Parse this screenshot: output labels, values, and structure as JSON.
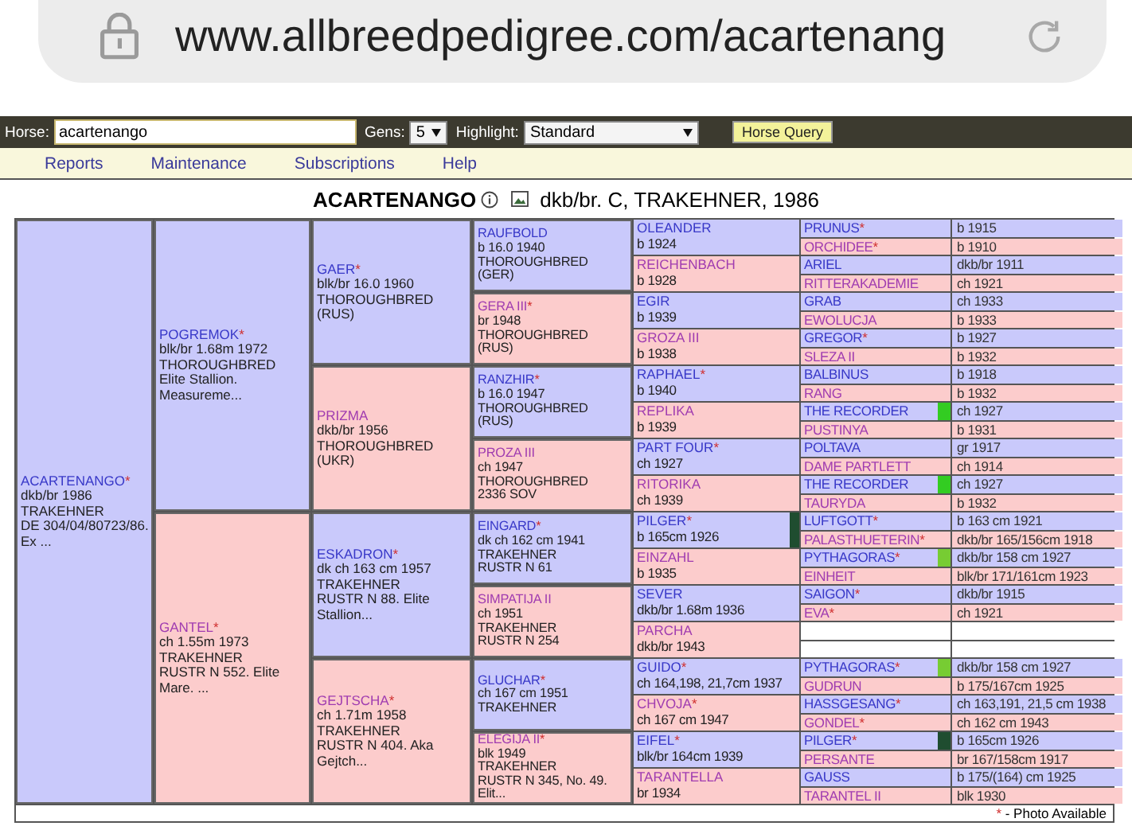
{
  "browser": {
    "url": "www.allbreedpedigree.com/acartenang"
  },
  "query_bar": {
    "horse_label": "Horse:",
    "horse_value": "acartenango",
    "gens_label": "Gens:",
    "gens_value": "5",
    "highlight_label": "Highlight:",
    "highlight_value": "Standard",
    "button": "Horse Query"
  },
  "menu": [
    "Reports",
    "Maintenance",
    "Subscriptions",
    "Help"
  ],
  "title": {
    "name": "ACARTENANGO",
    "details": "dkb/br. C, TRAKEHNER, 1986"
  },
  "pedigree": {
    "kind": "male",
    "name": "ACARTENANGO",
    "mark": "*",
    "info": [
      "dkb/br 1986",
      "TRAKEHNER",
      "DE 304/04/80723/86. Ex ..."
    ],
    "children": [
      {
        "kind": "male",
        "name": "POGREMOK",
        "mark": "*",
        "info": [
          "blk/br 1.68m 1972",
          "THOROUGHBRED",
          "Elite Stallion. Measureme..."
        ],
        "children": [
          {
            "kind": "male",
            "name": "GAER",
            "mark": "*",
            "info": [
              "blk/br 16.0 1960",
              "THOROUGHBRED",
              "(RUS)"
            ],
            "children": [
              {
                "kind": "male",
                "name": "RAUFBOLD",
                "info": [
                  "b 16.0 1940",
                  "THOROUGHBRED",
                  "(GER)"
                ],
                "children": [
                  {
                    "kind": "male",
                    "name": "OLEANDER",
                    "info": [
                      "b 1924"
                    ],
                    "children": [
                      {
                        "kind": "male",
                        "name": "PRUNUS",
                        "mark": "*",
                        "info": [
                          "b 1915"
                        ]
                      },
                      {
                        "kind": "female",
                        "name": "ORCHIDEE",
                        "mark": "*",
                        "info": [
                          "b 1910"
                        ]
                      }
                    ]
                  },
                  {
                    "kind": "female",
                    "name": "REICHENBACH",
                    "info": [
                      "b 1928"
                    ],
                    "children": [
                      {
                        "kind": "male",
                        "name": "ARIEL",
                        "info": [
                          "dkb/br 1911"
                        ]
                      },
                      {
                        "kind": "female",
                        "name": "RITTERAKADEMIE",
                        "info": [
                          "ch 1921"
                        ]
                      }
                    ]
                  }
                ]
              },
              {
                "kind": "female",
                "name": "GERA III",
                "mark": "*",
                "info": [
                  "br 1948",
                  "THOROUGHBRED",
                  "(RUS)"
                ],
                "children": [
                  {
                    "kind": "male",
                    "name": "EGIR",
                    "info": [
                      "b 1939"
                    ],
                    "children": [
                      {
                        "kind": "male",
                        "name": "GRAB",
                        "info": [
                          "ch 1933"
                        ]
                      },
                      {
                        "kind": "female",
                        "name": "EWOLUCJA",
                        "info": [
                          "b 1933"
                        ]
                      }
                    ]
                  },
                  {
                    "kind": "female",
                    "name": "GROZA III",
                    "info": [
                      "b 1938"
                    ],
                    "children": [
                      {
                        "kind": "male",
                        "name": "GREGOR",
                        "mark": "*",
                        "info": [
                          "b 1927"
                        ]
                      },
                      {
                        "kind": "female",
                        "name": "SLEZA II",
                        "info": [
                          "b 1932"
                        ]
                      }
                    ]
                  }
                ]
              }
            ]
          },
          {
            "kind": "female",
            "name": "PRIZMA",
            "info": [
              "dkb/br 1956",
              "THOROUGHBRED",
              "(UKR)"
            ],
            "children": [
              {
                "kind": "male",
                "name": "RANZHIR",
                "mark": "*",
                "info": [
                  "b 16.0 1947",
                  "THOROUGHBRED",
                  "(RUS)"
                ],
                "children": [
                  {
                    "kind": "male",
                    "name": "RAPHAEL",
                    "mark": "*",
                    "info": [
                      "b 1940"
                    ],
                    "children": [
                      {
                        "kind": "male",
                        "name": "BALBINUS",
                        "info": [
                          "b 1918"
                        ]
                      },
                      {
                        "kind": "female",
                        "name": "RANG",
                        "info": [
                          "b 1932"
                        ]
                      }
                    ]
                  },
                  {
                    "kind": "female",
                    "name": "REPLIKA",
                    "info": [
                      "b 1939"
                    ],
                    "children": [
                      {
                        "kind": "male",
                        "name": "THE RECORDER",
                        "color": "#33cc22",
                        "info": [
                          "ch 1927"
                        ]
                      },
                      {
                        "kind": "female",
                        "name": "PUSTINYA",
                        "info": [
                          "b 1931"
                        ]
                      }
                    ]
                  }
                ]
              },
              {
                "kind": "female",
                "name": "PROZA III",
                "info": [
                  "ch 1947",
                  "THOROUGHBRED",
                  "2336 SOV"
                ],
                "children": [
                  {
                    "kind": "male",
                    "name": "PART FOUR",
                    "mark": "*",
                    "info": [
                      "ch 1927"
                    ],
                    "children": [
                      {
                        "kind": "male",
                        "name": "POLTAVA",
                        "info": [
                          "gr 1917"
                        ]
                      },
                      {
                        "kind": "female",
                        "name": "DAME PARTLETT",
                        "info": [
                          "ch 1914"
                        ]
                      }
                    ]
                  },
                  {
                    "kind": "female",
                    "name": "RITORIKA",
                    "info": [
                      "ch 1939"
                    ],
                    "children": [
                      {
                        "kind": "male",
                        "name": "THE RECORDER",
                        "color": "#33cc22",
                        "info": [
                          "ch 1927"
                        ]
                      },
                      {
                        "kind": "female",
                        "name": "TAURYDA",
                        "info": [
                          "b 1932"
                        ]
                      }
                    ]
                  }
                ]
              }
            ]
          }
        ]
      },
      {
        "kind": "female",
        "name": "GANTEL",
        "mark": "*",
        "info": [
          "ch 1.55m 1973",
          "TRAKEHNER",
          "RUSTR N 552. Elite Mare. ..."
        ],
        "children": [
          {
            "kind": "male",
            "name": "ESKADRON",
            "mark": "*",
            "info": [
              "dk ch 163 cm 1957",
              "TRAKEHNER",
              "RUSTR N 88. Elite Stallion..."
            ],
            "children": [
              {
                "kind": "male",
                "name": "EINGARD",
                "mark": "*",
                "info": [
                  "dk ch 162 cm 1941",
                  "TRAKEHNER",
                  "RUSTR N 61"
                ],
                "children": [
                  {
                    "kind": "male",
                    "name": "PILGER",
                    "mark": "*",
                    "color": "#1f4d30",
                    "info": [
                      "b 165cm 1926"
                    ],
                    "children": [
                      {
                        "kind": "male",
                        "name": "LUFTGOTT",
                        "mark": "*",
                        "info": [
                          "b 163 cm 1921"
                        ]
                      },
                      {
                        "kind": "female",
                        "name": "PALASTHUETERIN",
                        "mark": "*",
                        "info": [
                          "dkb/br 165/156cm 1918"
                        ]
                      }
                    ]
                  },
                  {
                    "kind": "female",
                    "name": "EINZAHL",
                    "info": [
                      "b 1935"
                    ],
                    "children": [
                      {
                        "kind": "male",
                        "name": "PYTHAGORAS",
                        "mark": "*",
                        "color": "#77cc33",
                        "info": [
                          "dkb/br 158 cm 1927"
                        ]
                      },
                      {
                        "kind": "female",
                        "name": "EINHEIT",
                        "info": [
                          "blk/br 171/161cm 1923"
                        ]
                      }
                    ]
                  }
                ]
              },
              {
                "kind": "female",
                "name": "SIMPATIJA II",
                "info": [
                  "ch 1951",
                  "TRAKEHNER",
                  "RUSTR N 254"
                ],
                "children": [
                  {
                    "kind": "male",
                    "name": "SEVER",
                    "info": [
                      "dkb/br 1.68m 1936"
                    ],
                    "children": [
                      {
                        "kind": "male",
                        "name": "SAIGON",
                        "mark": "*",
                        "info": [
                          "dkb/br 1915"
                        ]
                      },
                      {
                        "kind": "female",
                        "name": "EVA",
                        "mark": "*",
                        "info": [
                          "ch 1921"
                        ]
                      }
                    ]
                  },
                  {
                    "kind": "female",
                    "name": "PARCHA",
                    "info": [
                      "dkb/br 1943"
                    ]
                  }
                ]
              }
            ]
          },
          {
            "kind": "female",
            "name": "GEJTSCHA",
            "mark": "*",
            "info": [
              "ch 1.71m 1958",
              "TRAKEHNER",
              "RUSTR N 404. Aka Gejtch..."
            ],
            "children": [
              {
                "kind": "male",
                "name": "GLUCHAR",
                "mark": "*",
                "info": [
                  "ch 167 cm 1951",
                  "TRAKEHNER"
                ],
                "children": [
                  {
                    "kind": "male",
                    "name": "GUIDO",
                    "mark": "*",
                    "info": [
                      "ch 164,198, 21,7cm 1937"
                    ],
                    "children": [
                      {
                        "kind": "male",
                        "name": "PYTHAGORAS",
                        "mark": "*",
                        "color": "#77cc33",
                        "info": [
                          "dkb/br 158 cm 1927"
                        ]
                      },
                      {
                        "kind": "female",
                        "name": "GUDRUN",
                        "info": [
                          "b 175/167cm 1925"
                        ]
                      }
                    ]
                  },
                  {
                    "kind": "female",
                    "name": "CHVOJA",
                    "mark": "*",
                    "info": [
                      "ch 167 cm 1947"
                    ],
                    "children": [
                      {
                        "kind": "male",
                        "name": "HASSGESANG",
                        "mark": "*",
                        "info": [
                          "ch 163,191, 21,5 cm 1938"
                        ]
                      },
                      {
                        "kind": "female",
                        "name": "GONDEL",
                        "mark": "*",
                        "info": [
                          "ch 162 cm 1943"
                        ]
                      }
                    ]
                  }
                ]
              },
              {
                "kind": "female",
                "name": "ELEGIJA II",
                "mark": "*",
                "info": [
                  "blk 1949",
                  "TRAKEHNER",
                  "RUSTR N 345, No. 49. Elit..."
                ],
                "children": [
                  {
                    "kind": "male",
                    "name": "EIFEL",
                    "mark": "*",
                    "info": [
                      "blk/br 164cm 1939"
                    ],
                    "children": [
                      {
                        "kind": "male",
                        "name": "PILGER",
                        "mark": "*",
                        "color": "#1f4d30",
                        "info": [
                          "b 165cm 1926"
                        ]
                      },
                      {
                        "kind": "female",
                        "name": "PERSANTE",
                        "info": [
                          "br 167/158cm 1917"
                        ]
                      }
                    ]
                  },
                  {
                    "kind": "female",
                    "name": "TARANTELLA",
                    "info": [
                      "br 1934"
                    ],
                    "children": [
                      {
                        "kind": "male",
                        "name": "GAUSS",
                        "info": [
                          "b 175/(164) cm 1925"
                        ]
                      },
                      {
                        "kind": "female",
                        "name": "TARANTEL II",
                        "info": [
                          "blk 1930"
                        ]
                      }
                    ]
                  }
                ]
              }
            ]
          }
        ]
      }
    ]
  },
  "footer": {
    "mark": "*",
    "text": "- Photo Available"
  }
}
